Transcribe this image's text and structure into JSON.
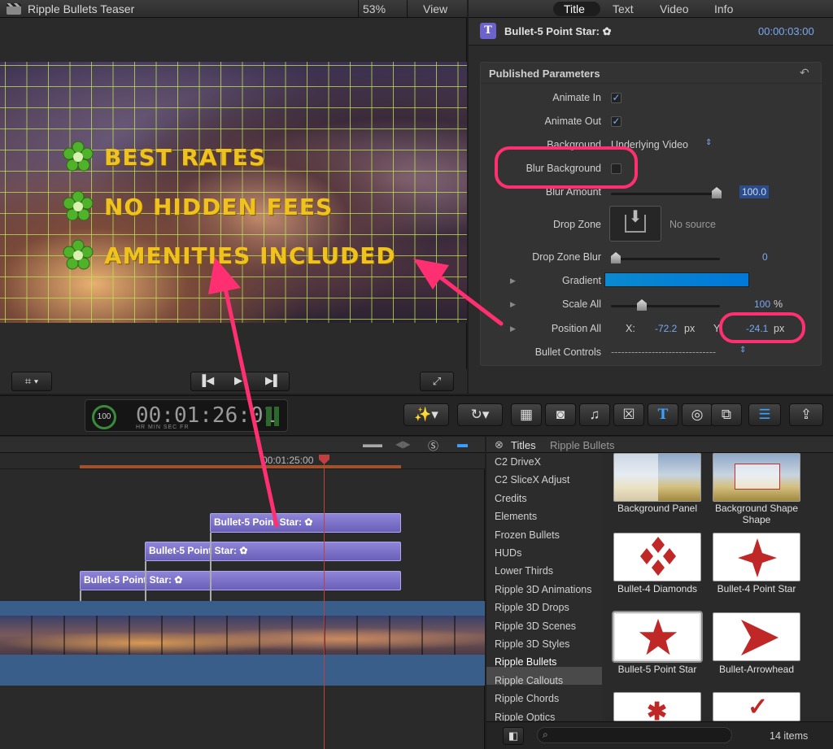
{
  "viewer": {
    "title": "Ripple Bullets Teaser",
    "zoom": "53%",
    "view_label": "View",
    "bullets": [
      "BEST RATES",
      "NO HIDDEN FEES",
      "AMENITIES INCLUDED"
    ]
  },
  "inspector": {
    "tabs": [
      "Title",
      "Text",
      "Video",
      "Info"
    ],
    "active_tab": "Title",
    "clip_name": "Bullet-5 Point Star: ✿",
    "clip_time": "00:00:03:00",
    "section_title": "Published Parameters",
    "params": {
      "animate_in": "Animate In",
      "animate_out": "Animate Out",
      "background": "Background",
      "background_value": "Underlying Video",
      "blur_background": "Blur Background",
      "blur_amount": "Blur Amount",
      "blur_amount_value": "100.0",
      "drop_zone": "Drop Zone",
      "drop_zone_value": "No source",
      "drop_zone_blur": "Drop Zone Blur",
      "drop_zone_blur_value": "0",
      "gradient": "Gradient",
      "scale_all": "Scale All",
      "scale_all_value": "100",
      "scale_unit": "%",
      "position_all": "Position All",
      "x_label": "X:",
      "x_value": "-72.2",
      "y_label": "Y:",
      "y_value": "-24.1",
      "unit_px": "px",
      "bullet_controls": "Bullet Controls",
      "bullet_controls_value": "-------------------------------"
    }
  },
  "toolbar": {
    "timecode": "00:01:26:01",
    "tc_units": "HR   MIN   SEC   FR",
    "percent": "100"
  },
  "timeline": {
    "ruler_time": "00:01:25:00",
    "clips": [
      "Bullet-5 Point Star: ✿",
      "Bullet-5 Point Star: ✿",
      "Bullet-5 Point Star: ✿"
    ]
  },
  "browser": {
    "title": "Titles",
    "subtitle": "Ripple Bullets",
    "categories": [
      "C2 DriveX",
      "C2 SliceX Adjust",
      "Credits",
      "Elements",
      "Frozen Bullets",
      "HUDs",
      "Lower Thirds",
      "Ripple 3D Animations",
      "Ripple 3D Drops",
      "Ripple 3D Scenes",
      "Ripple 3D Styles",
      "Ripple Bullets",
      "Ripple Callouts",
      "Ripple Chords",
      "Ripple Optics"
    ],
    "selected_category": "Ripple Bullets",
    "items": [
      "Background Panel",
      "Background Shape",
      "Bullet-4 Diamonds",
      "Bullet-4 Point Star",
      "Bullet-5 Point Star",
      "Bullet-Arrowhead"
    ],
    "count": "14 items"
  },
  "colors": {
    "highlight": "#ff2f72",
    "accent_blue": "#7aa8f0",
    "clip_purple": "#7a70c8",
    "bullet_yellow": "#f0c21e"
  }
}
